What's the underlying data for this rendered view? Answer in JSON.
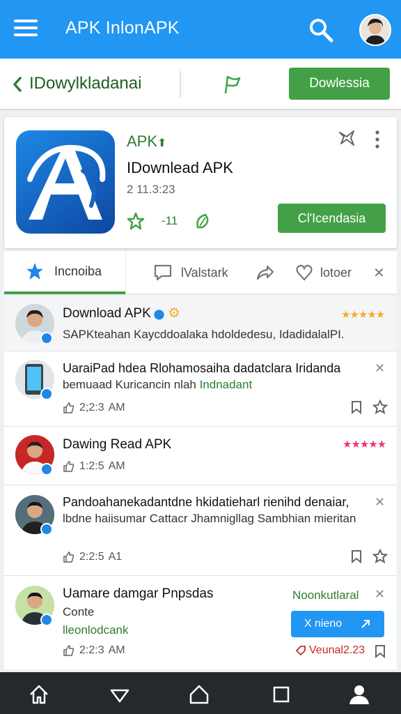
{
  "appbar": {
    "title": "APK InlonAPK"
  },
  "toolbar": {
    "title": "IDowylkladanai",
    "download_label": "Dowlessia"
  },
  "app_card": {
    "label": "APK",
    "title": "IDownlead APK",
    "version": "2 11.3:23",
    "stat_label": "-11",
    "download_label": "Cl'Icendasia",
    "colors": {
      "accent": "#43a047",
      "brand": "#2196f3"
    }
  },
  "tabs": [
    {
      "label": "Incnoiba"
    },
    {
      "label": "lValstark"
    },
    {
      "label": "lotoer"
    }
  ],
  "list": [
    {
      "title": "Download APK",
      "body": "SAPKteahan Kaycddoalaka hdoldedesu, IdadidalalPI.",
      "stars": "★★★★★"
    },
    {
      "title": "UaraiPad hdea Rlohamosaiha dadatclara  Iridanda",
      "body_plain": "bemuaad Kuricancin nlah ",
      "body_green": "Indnadant",
      "time": "2;2:3",
      "period": "AM"
    },
    {
      "title": "Dawing Read APK",
      "time": "1:2:5",
      "period": "AM",
      "stars": "★★★★★"
    },
    {
      "title": "Pandoahanekadantdne hkidatieharl rienihd denaiar,",
      "body": "lbdne haiisumar Cattacr Jhamnigllag Sambhian mieritan",
      "time": "2:2:5",
      "period": "A1"
    },
    {
      "title": "Uamare damgar Pnpsdas",
      "subtitle": "Conte",
      "green_label": "lleonlodcank",
      "right_label": "Noonkutlaral",
      "time": "2:2:3",
      "period": "AM"
    }
  ],
  "floating": {
    "button_label": "X nieno",
    "tag": "Veunal2.23"
  }
}
